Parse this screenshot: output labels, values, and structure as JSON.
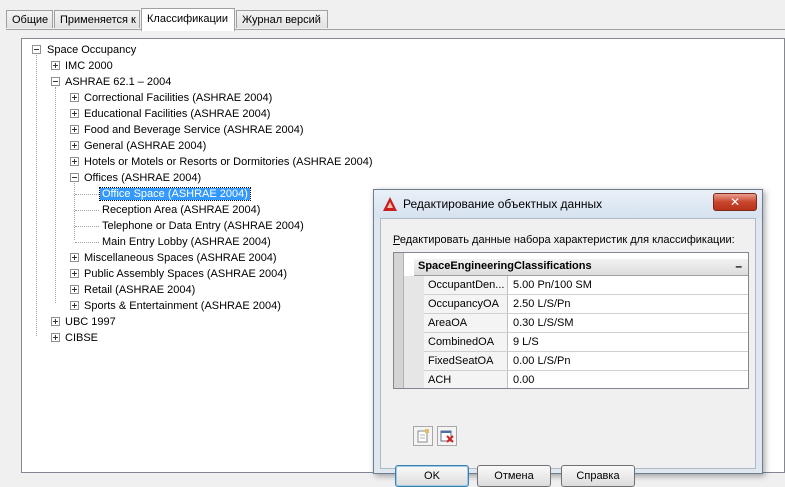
{
  "tabs": [
    {
      "label": "Общие"
    },
    {
      "label": "Применяется к"
    },
    {
      "label": "Классификации",
      "active": true
    },
    {
      "label": "Журнал версий"
    }
  ],
  "tree": {
    "root": "Space Occupancy",
    "imc": "IMC 2000",
    "ashrae": "ASHRAE 62.1 – 2004",
    "ashrae_children": [
      "Correctional Facilities (ASHRAE 2004)",
      "Educational Facilities (ASHRAE 2004)",
      "Food and Beverage Service (ASHRAE 2004)",
      "General (ASHRAE 2004)",
      "Hotels or Motels or Resorts or Dormitories (ASHRAE 2004)",
      "Offices (ASHRAE 2004)",
      "Miscellaneous Spaces (ASHRAE 2004)",
      "Public Assembly Spaces (ASHRAE 2004)",
      "Retail (ASHRAE 2004)",
      "Sports & Entertainment (ASHRAE 2004)"
    ],
    "offices_children": [
      "Office Space (ASHRAE 2004)",
      "Reception Area (ASHRAE 2004)",
      "Telephone or Data Entry (ASHRAE 2004)",
      "Main Entry Lobby (ASHRAE 2004)"
    ],
    "ubc": "UBC 1997",
    "cibse": "CIBSE"
  },
  "dialog": {
    "title": "Редактирование объектных данных",
    "close_label": "✕",
    "prompt_first": "Р",
    "prompt_rest": "едактировать данные набора характеристик для классификации:",
    "group_title": "SpaceEngineeringClassifications",
    "group_collapse": "–",
    "rows": [
      {
        "name": "OccupantDen...",
        "value": "5.00 Pn/100 SM"
      },
      {
        "name": "OccupancyOA",
        "value": "2.50  L/S/Pn"
      },
      {
        "name": "AreaOA",
        "value": "0.30 L/S/SM"
      },
      {
        "name": "CombinedOA",
        "value": "9 L/S"
      },
      {
        "name": "FixedSeatOA",
        "value": "0.00  L/S/Pn"
      },
      {
        "name": "ACH",
        "value": "0.00"
      }
    ],
    "ok_label": "OK",
    "cancel_label": "Отмена",
    "help_label": "Справка"
  },
  "colors": {
    "selection": "#3399ff",
    "title_bar": "#dce6f1",
    "close_button": "#c8452c"
  }
}
